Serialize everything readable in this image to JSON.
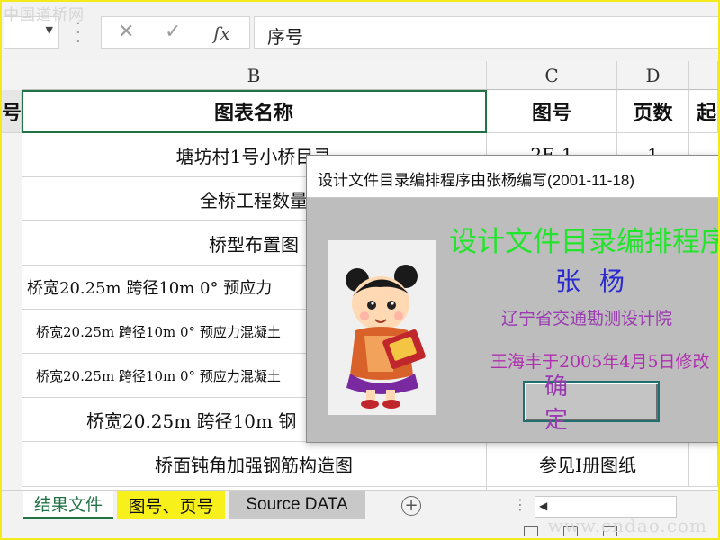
{
  "watermark": {
    "top": "中国道桥网",
    "bottom": "www.cndao.com"
  },
  "formula_bar": {
    "name_box": "",
    "cancel_icon": "✕",
    "enter_icon": "✓",
    "fx_label": "fx",
    "content": "序号"
  },
  "columns": {
    "a_partial": "",
    "b": "B",
    "c": "C",
    "d": "D"
  },
  "table": {
    "header": {
      "a_partial": "号",
      "b": "图表名称",
      "c": "图号",
      "d": "页数",
      "e_partial": "起"
    },
    "rows": [
      {
        "b": "塘坊村1号小桥目录",
        "c": "2E-1",
        "d": "1"
      },
      {
        "b": "全桥工程数量",
        "c": "",
        "d": ""
      },
      {
        "b": "桥型布置图",
        "c": "",
        "d": ""
      },
      {
        "b": "桥宽20.25m 跨径10m 0° 预应力",
        "c": "",
        "d": ""
      },
      {
        "b": "桥宽20.25m 跨径10m 0° 预应力混凝土",
        "c": "",
        "d": ""
      },
      {
        "b": "桥宽20.25m 跨径10m 0° 预应力混凝土",
        "c": "",
        "d": ""
      },
      {
        "b": "桥宽20.25m 跨径10m 钢",
        "c": "",
        "d": ""
      },
      {
        "b": "桥面钝角加强钢筋构造图",
        "c": "参见I册图纸",
        "d": ""
      }
    ]
  },
  "dialog": {
    "title": "设计文件目录编排程序由张杨编写(2001-11-18)",
    "headline": "设计文件目录编排程序",
    "author": "张 杨",
    "organization": "辽宁省交通勘测设计院",
    "modified_note": "王海丰于2005年4月5日修改",
    "ok_label": "确 定",
    "colors": {
      "headline": "#22e52b",
      "author": "#2a2ad0",
      "organization": "#9a3bb0",
      "background": "#bdbdbd"
    }
  },
  "sheet_tabs": [
    {
      "label": "结果文件",
      "active": true
    },
    {
      "label": "图号、页号",
      "active": false
    },
    {
      "label": "Source DATA",
      "active": false
    }
  ],
  "status": {
    "add_sheet_label": "+",
    "tab_dots": "⋮"
  }
}
